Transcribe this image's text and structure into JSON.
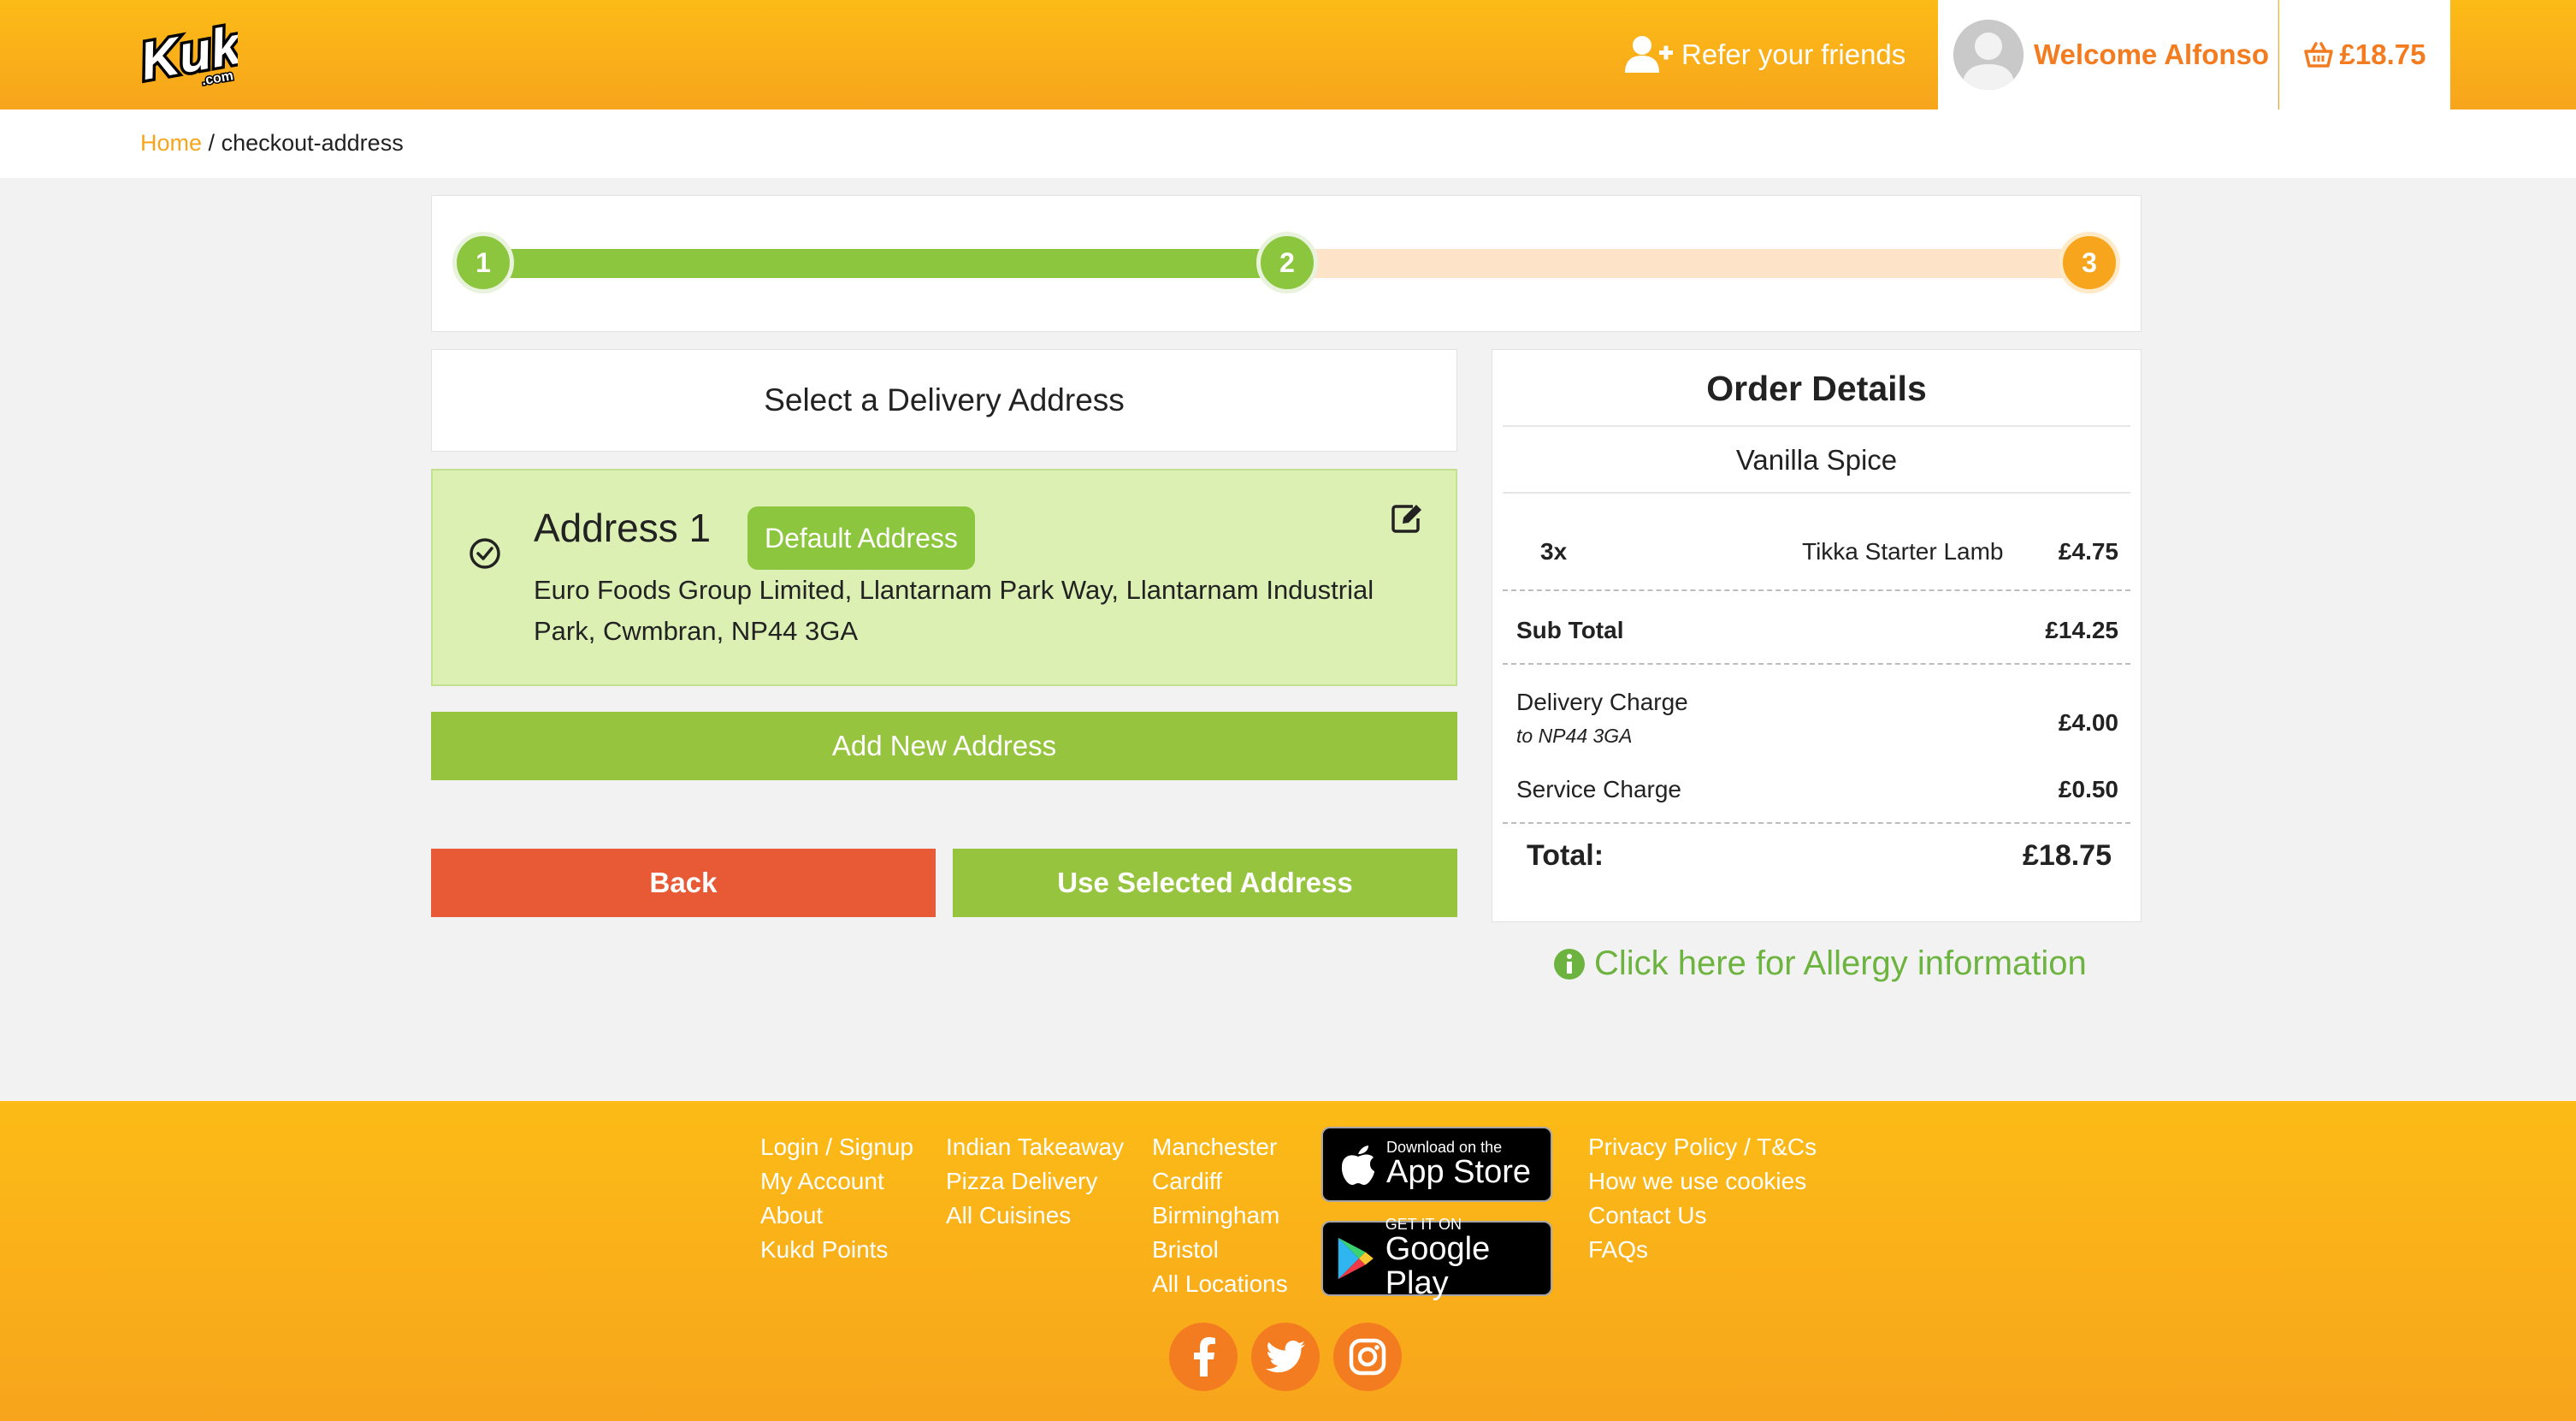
{
  "header": {
    "logo_text": "Kukd",
    "logo_sub": ".com",
    "refer_label": "Refer your friends",
    "welcome_label": "Welcome Alfonso",
    "cart_total": "£18.75",
    "brand_color": "#fcbb16",
    "accent_color": "#f47c20"
  },
  "breadcrumb": {
    "home": "Home",
    "separator": "/",
    "current": "checkout-address"
  },
  "progress": {
    "steps": [
      "1",
      "2",
      "3"
    ],
    "completed_fraction": 0.5,
    "done_color": "#8cc63f",
    "active_color": "#f7a51c"
  },
  "address_section": {
    "heading": "Select a Delivery Address",
    "selected_address": {
      "name": "Address 1",
      "badge": "Default Address",
      "text": "Euro Foods Group Limited, Llantarnam Park Way, Llantarnam Industrial Park, Cwmbran, NP44 3GA",
      "selected": true
    },
    "add_button": "Add New Address",
    "back_button": "Back",
    "use_button": "Use Selected Address"
  },
  "order": {
    "title": "Order Details",
    "restaurant": "Vanilla Spice",
    "items": [
      {
        "qty": "3x",
        "name": "Tikka Starter Lamb",
        "price": "£4.75"
      }
    ],
    "subtotal_label": "Sub Total",
    "subtotal": "£14.25",
    "delivery_label": "Delivery Charge",
    "delivery_note": "to NP44 3GA",
    "delivery": "£4.00",
    "service_label": "Service Charge",
    "service": "£0.50",
    "total_label": "Total:",
    "total": "£18.75"
  },
  "allergy_link": "Click here for Allergy information",
  "footer": {
    "col1": [
      "Login / Signup",
      "My Account",
      "About",
      "Kukd Points"
    ],
    "col2": [
      "Indian Takeaway",
      "Pizza Delivery",
      "All Cuisines"
    ],
    "col3": [
      "Manchester",
      "Cardiff",
      "Birmingham",
      "Bristol",
      "All Locations"
    ],
    "col4": [
      "Privacy Policy / T&Cs",
      "How we use cookies",
      "Contact Us",
      "FAQs"
    ],
    "app_store": {
      "small": "Download on the",
      "big": "App Store"
    },
    "google_play": {
      "small": "GET IT ON",
      "big": "Google Play"
    },
    "social_icons": [
      "facebook-icon",
      "twitter-icon",
      "instagram-icon"
    ]
  }
}
